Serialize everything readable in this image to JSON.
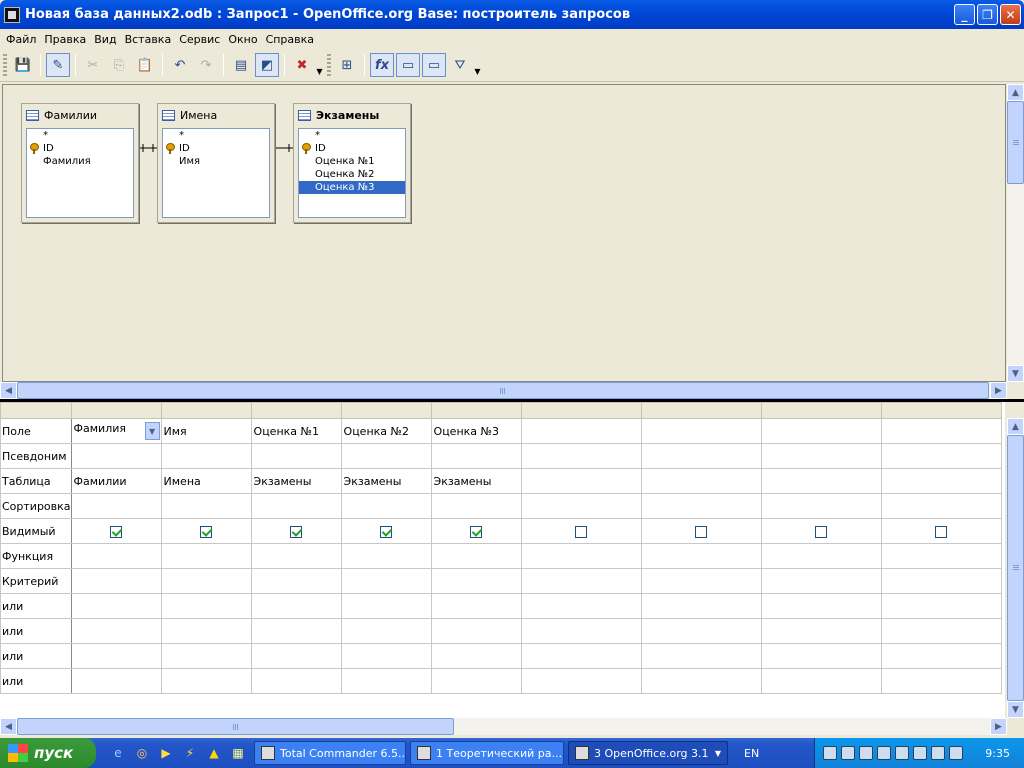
{
  "window": {
    "title": "Новая база данных2.odb : Запрос1 - OpenOffice.org Base: построитель запросов",
    "buttons": {
      "minimize": "_",
      "maximize": "❐",
      "close": "✕"
    }
  },
  "menubar": {
    "items": [
      "Файл",
      "Правка",
      "Вид",
      "Вставка",
      "Сервис",
      "Окно",
      "Справка"
    ]
  },
  "toolbar": {
    "buttons": [
      {
        "name": "save-icon",
        "glyph": "💾",
        "enabled": true
      },
      {
        "name": "edit-mode-icon",
        "glyph": "✎",
        "enabled": true,
        "active": true
      },
      {
        "name": "cut-icon",
        "glyph": "✂",
        "enabled": false
      },
      {
        "name": "copy-icon",
        "glyph": "⎘",
        "enabled": false
      },
      {
        "name": "paste-icon",
        "glyph": "📋",
        "enabled": false
      },
      {
        "name": "undo-icon",
        "glyph": "↶",
        "enabled": true
      },
      {
        "name": "redo-icon",
        "glyph": "↷",
        "enabled": false
      },
      {
        "name": "run-query-icon",
        "glyph": "▤",
        "enabled": true
      },
      {
        "name": "design-view-icon",
        "glyph": "◩",
        "enabled": true,
        "active": true
      },
      {
        "name": "clear-query-icon",
        "glyph": "✖",
        "enabled": true
      },
      {
        "name": "add-table-icon",
        "glyph": "⊞",
        "enabled": true
      },
      {
        "name": "functions-icon",
        "glyph": "fx",
        "enabled": true,
        "active": true
      },
      {
        "name": "table-name-icon",
        "glyph": "▭",
        "enabled": true,
        "active": true
      },
      {
        "name": "alias-icon",
        "glyph": "▭",
        "enabled": true,
        "active": true
      },
      {
        "name": "distinct-values-icon",
        "glyph": "⛛",
        "enabled": true
      }
    ]
  },
  "tables": [
    {
      "title": "Фамилии",
      "fields": [
        "*",
        "ID",
        "Фамилия"
      ],
      "key_field": "ID",
      "selected": null,
      "bold": false
    },
    {
      "title": "Имена",
      "fields": [
        "*",
        "ID",
        "Имя"
      ],
      "key_field": "ID",
      "selected": null,
      "bold": false
    },
    {
      "title": "Экзамены",
      "fields": [
        "*",
        "ID",
        "Оценка №1",
        "Оценка №2",
        "Оценка №3"
      ],
      "key_field": "ID",
      "selected": "Оценка №3",
      "bold": true
    }
  ],
  "grid": {
    "row_labels": [
      "Поле",
      "Псевдоним",
      "Таблица",
      "Сортировка",
      "Видимый",
      "Функция",
      "Критерий",
      "или",
      "или",
      "или",
      "или"
    ],
    "columns": [
      {
        "field": "Фамилия",
        "table": "Фамилии",
        "visible": true,
        "dropdown": true
      },
      {
        "field": "Имя",
        "table": "Имена",
        "visible": true
      },
      {
        "field": "Оценка №1",
        "table": "Экзамены",
        "visible": true
      },
      {
        "field": "Оценка №2",
        "table": "Экзамены",
        "visible": true
      },
      {
        "field": "Оценка №3",
        "table": "Экзамены",
        "visible": true
      },
      {
        "field": "",
        "table": "",
        "visible": false
      },
      {
        "field": "",
        "table": "",
        "visible": false
      },
      {
        "field": "",
        "table": "",
        "visible": false
      },
      {
        "field": "",
        "table": "",
        "visible": false
      }
    ]
  },
  "taskbar": {
    "start_label": "пуск",
    "tasks": [
      {
        "label": "Total Commander 6.5...",
        "active": false
      },
      {
        "label": "1 Теоретический ра...",
        "active": false
      },
      {
        "label": "3 OpenOffice.org 3.1",
        "active": true
      }
    ],
    "language": "EN",
    "clock": "9:35"
  },
  "colors": {
    "title_bar": "#0054e3",
    "selection": "#316ac5",
    "start_button": "#3c9a3c",
    "check_mark": "#21a121"
  }
}
